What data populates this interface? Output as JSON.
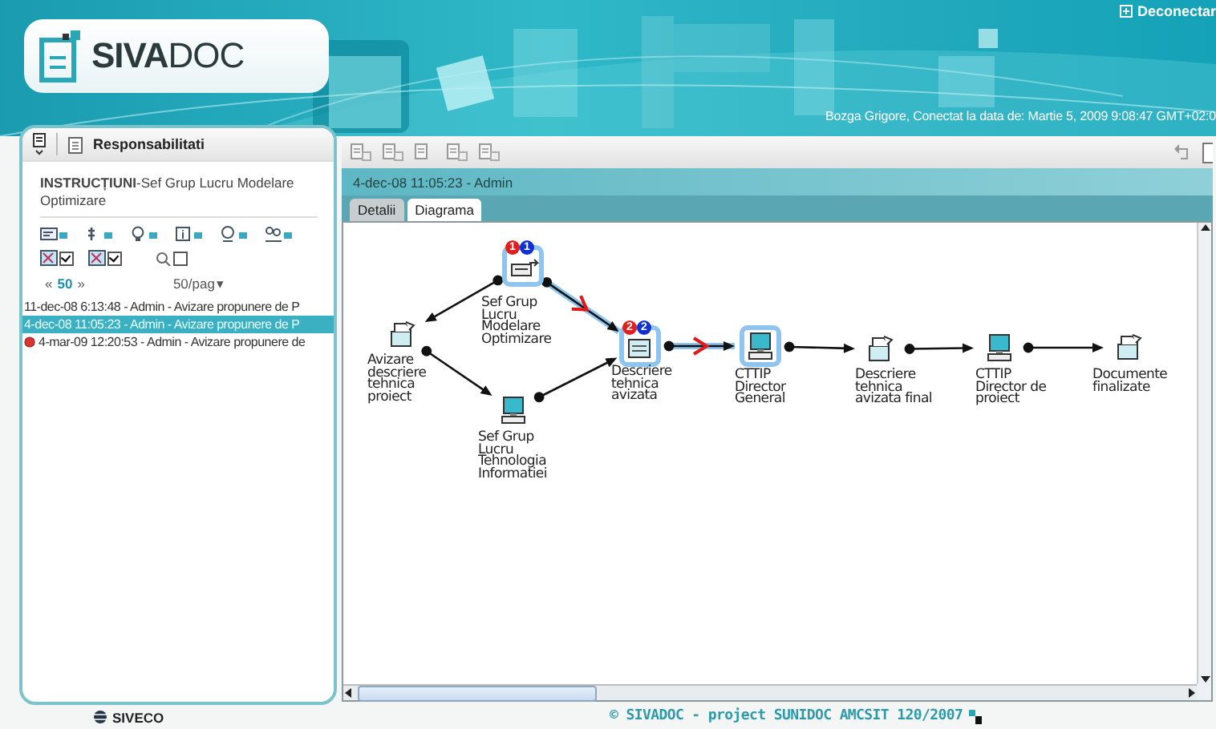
{
  "header": {
    "logo": "**SIVA**DOC",
    "logout": "Deconectar",
    "session": "Bozga Grigore, Conectat la data de: Martie 5, 2009 9:08:47 GMT+02:0"
  },
  "side": {
    "tab": "Responsabilitati",
    "title": "**INSTRUCȚIUNI**-Sef Grup Lucru Modelare Optimizare",
    "filters": [
      {
        "checked": true
      },
      {
        "checked": true
      },
      {
        "checked": false
      }
    ],
    "pager": {
      "prev": "«",
      "current": "50",
      "next": "»",
      "per_page": "50/pag",
      "caret": "▾"
    },
    "items": [
      {
        "text": "11-dec-08 6:13:48 - Admin - Avizare propunere de P",
        "selected": false,
        "alert": false
      },
      {
        "text": "4-dec-08 11:05:23 - Admin - Avizare propunere de P",
        "selected": true,
        "alert": false
      },
      {
        "text": "4-mar-09 12:20:53 - Admin - Avizare propunere de",
        "selected": false,
        "alert": true
      }
    ]
  },
  "main": {
    "heading": "4-dec-08 11:05:23 - Admin",
    "tabs": [
      {
        "label": "Detalii",
        "selected": false
      },
      {
        "label": "Diagrama",
        "selected": true
      }
    ],
    "diagram": {
      "nodes": [
        {
          "label": "Avizare descriere tehnica proiect",
          "kind": "folder",
          "highlighted": false
        },
        {
          "label": "Sef Grup Lucru Modelare Optimizare",
          "kind": "task",
          "highlighted": true,
          "badges": [
            {
              "text": "1",
              "color": "#e02020"
            },
            {
              "text": "1",
              "color": "#1030d0"
            }
          ]
        },
        {
          "label": "Sef Grup Lucru Tehnologia Informatiei",
          "kind": "computer",
          "highlighted": false
        },
        {
          "label": "Descriere tehnica avizata",
          "kind": "document",
          "highlighted": true,
          "badges": [
            {
              "text": "2",
              "color": "#e02020"
            },
            {
              "text": "2",
              "color": "#1030d0"
            }
          ]
        },
        {
          "label": "CTTIP Director General",
          "kind": "computer",
          "highlighted": true
        },
        {
          "label": "Descriere tehnica avizata final",
          "kind": "folder",
          "highlighted": false
        },
        {
          "label": "CTTIP Director de proiect",
          "kind": "computer",
          "highlighted": false
        },
        {
          "label": "Documente finalizate",
          "kind": "folder",
          "highlighted": false
        }
      ],
      "edges": [
        {
          "active": false
        },
        {
          "active": false
        },
        {
          "active": true
        },
        {
          "active": false
        },
        {
          "active": true
        },
        {
          "active": false
        },
        {
          "active": false
        },
        {
          "active": false
        }
      ]
    }
  },
  "footer": {
    "company": "SIVECO",
    "copyright": "© SIVADOC - project SUNIDOC AMCSIT 120/2007"
  }
}
